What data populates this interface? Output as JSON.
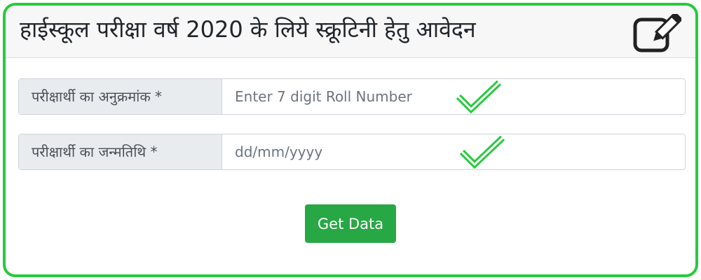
{
  "header": {
    "title": "हाईस्कूल परीक्षा वर्ष 2020 के लिये स्क्रूटिनी हेतु आवेदन",
    "icon": "edit-icon"
  },
  "form": {
    "roll": {
      "label": "परीक्षार्थी का अनुक्रमांक *",
      "placeholder": "Enter 7 digit Roll Number",
      "value": "",
      "validated": true
    },
    "dob": {
      "label": "परीक्षार्थी का जन्मतिथि *",
      "placeholder": "dd/mm/yyyy",
      "value": "",
      "validated": true
    },
    "submit_label": "Get Data"
  },
  "colors": {
    "accent_green": "#27c93f",
    "button_green": "#28a745"
  },
  "icons": {
    "validated": "checkmark-icon"
  }
}
